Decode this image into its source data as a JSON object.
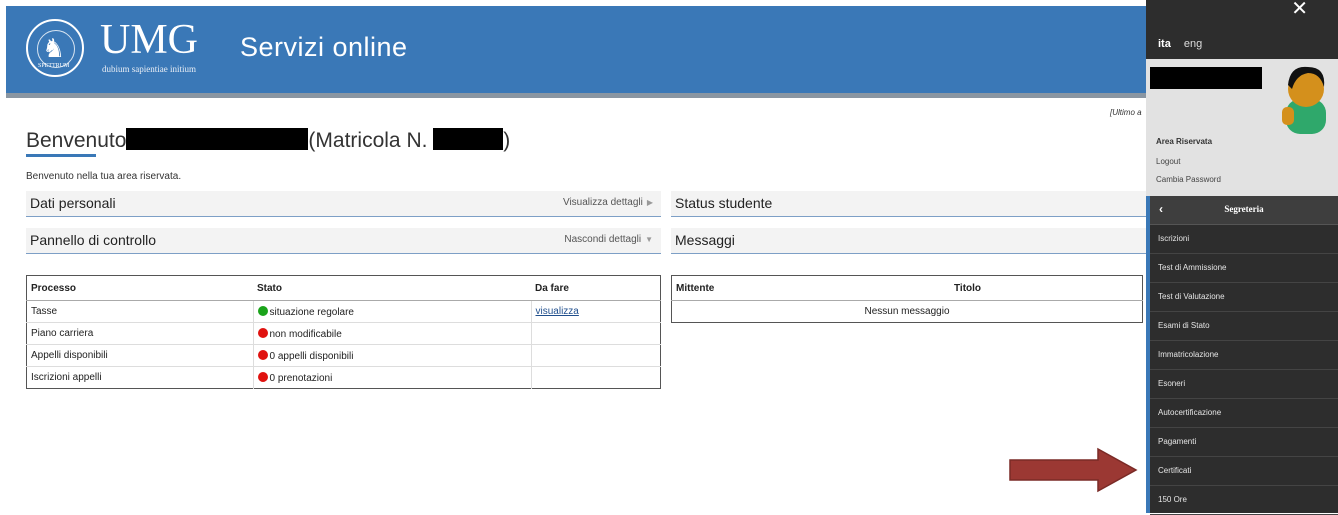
{
  "header": {
    "brand": "UMG",
    "brand_sub": "dubium sapientiae initium",
    "logo_band": "SPETTRUM",
    "service_title": "Servizi online",
    "last_access": "[Ultimo a"
  },
  "welcome": {
    "title": "Benvenuto",
    "matricola_label": "(Matricola N.",
    "matricola_close": ")",
    "subtitle": "Benvenuto nella tua area riservata."
  },
  "sections": {
    "dati_personali": {
      "title": "Dati personali",
      "action": "Visualizza dettagli",
      "arrow": "▶"
    },
    "pannello": {
      "title": "Pannello di controllo",
      "action": "Nascondi dettagli",
      "arrow": "▼"
    },
    "status": {
      "title": "Status studente"
    },
    "messaggi": {
      "title": "Messaggi"
    }
  },
  "process_table": {
    "headers": [
      "Processo",
      "Stato",
      "Da fare"
    ],
    "rows": [
      {
        "processo": "Tasse",
        "stato": "situazione regolare",
        "status_color": "#1aa31a",
        "da_fare": "visualizza"
      },
      {
        "processo": "Piano carriera",
        "stato": "non modificabile",
        "status_color": "#e0120f",
        "da_fare": ""
      },
      {
        "processo": "Appelli disponibili",
        "stato": "0 appelli disponibili",
        "status_color": "#e0120f",
        "da_fare": ""
      },
      {
        "processo": "Iscrizioni appelli",
        "stato": "0 prenotazioni",
        "status_color": "#e0120f",
        "da_fare": ""
      }
    ]
  },
  "messages_table": {
    "headers": [
      "Mittente",
      "Titolo"
    ],
    "empty": "Nessun messaggio"
  },
  "side_panel": {
    "close": "✕",
    "lang_ita": "ita",
    "lang_eng": "eng",
    "area_label": "Area Riservata",
    "logout": "Logout",
    "change_password": "Cambia Password",
    "section_title": "Segreteria",
    "back_icon": "‹",
    "menu": [
      "Iscrizioni",
      "Test di Ammissione",
      "Test di Valutazione",
      "Esami di Stato",
      "Immatricolazione",
      "Esoneri",
      "Autocertificazione",
      "Pagamenti",
      "Certificati",
      "150 Ore"
    ]
  },
  "colors": {
    "primary_blue": "#3a78b7",
    "sidebar_dark": "#2d2d2d",
    "annotation_arrow": "#9b3833"
  }
}
